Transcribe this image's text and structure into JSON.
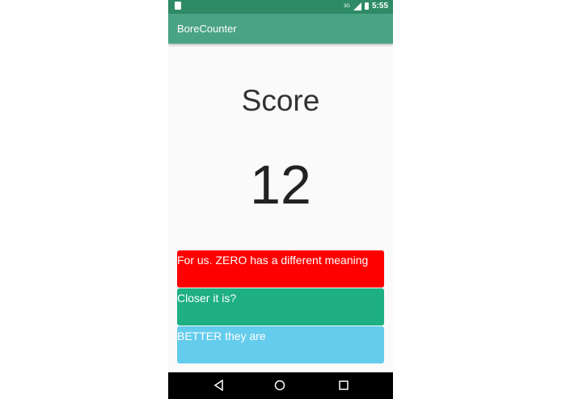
{
  "status_bar": {
    "time": "5:55",
    "network": "3G"
  },
  "app_bar": {
    "title": "BoreCounter"
  },
  "score": {
    "label": "Score",
    "value": "12"
  },
  "answers": [
    {
      "label": "For us. ZERO has a different meaning",
      "color": "#ff0000"
    },
    {
      "label": "Closer it is?",
      "color": "#1eaf82"
    },
    {
      "label": "BETTER they are",
      "color": "#64ccec"
    }
  ],
  "colors": {
    "status_bar": "#2e8b66",
    "app_bar": "#4aa384",
    "nav_bar": "#000000"
  },
  "nav_bar": {
    "icons": [
      "back-icon",
      "home-icon",
      "recent-apps-icon"
    ]
  }
}
